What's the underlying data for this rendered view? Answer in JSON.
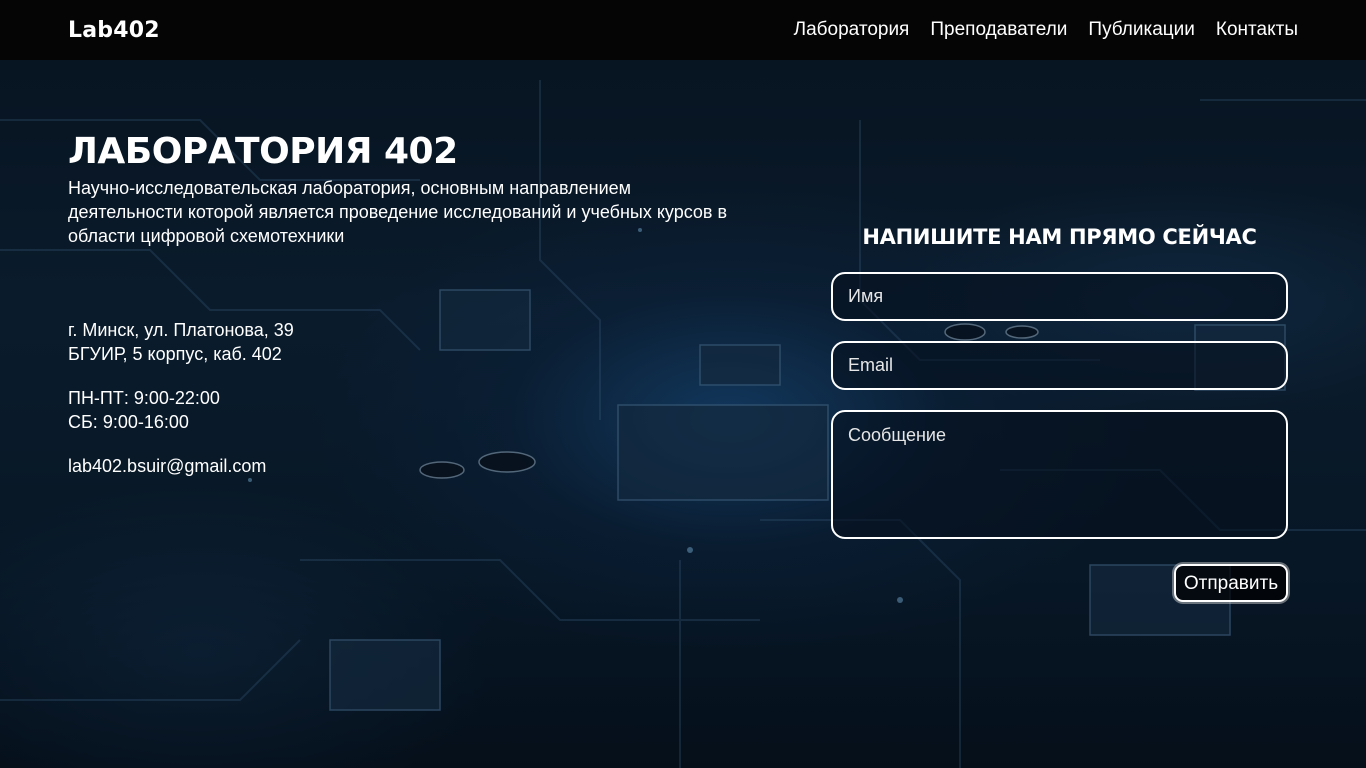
{
  "header": {
    "logo": "Lab402",
    "nav": [
      {
        "label": "Лаборатория"
      },
      {
        "label": "Преподаватели"
      },
      {
        "label": "Публикации"
      },
      {
        "label": "Контакты"
      }
    ]
  },
  "hero": {
    "title": "ЛАБОРАТОРИЯ 402",
    "description": "Научно-исследовательская лаборатория, основным направлением деятельности которой является проведение исследований и учебных курсов в области цифровой схемотехники"
  },
  "contacts": {
    "address_line1": "г. Минск, ул. Платонова, 39",
    "address_line2": "БГУИР, 5 корпус, каб. 402",
    "hours_weekdays": "ПН-ПТ: 9:00-22:00",
    "hours_saturday": "СБ: 9:00-16:00",
    "email": "lab402.bsuir@gmail.com"
  },
  "form": {
    "title": "НАПИШИТЕ НАМ ПРЯМО СЕЙЧАС",
    "name_placeholder": "Имя",
    "email_placeholder": "Email",
    "message_placeholder": "Сообщение",
    "submit_label": "Отправить"
  },
  "colors": {
    "header_bg": "#050505",
    "text": "#ffffff",
    "field_border": "#ffffff"
  }
}
